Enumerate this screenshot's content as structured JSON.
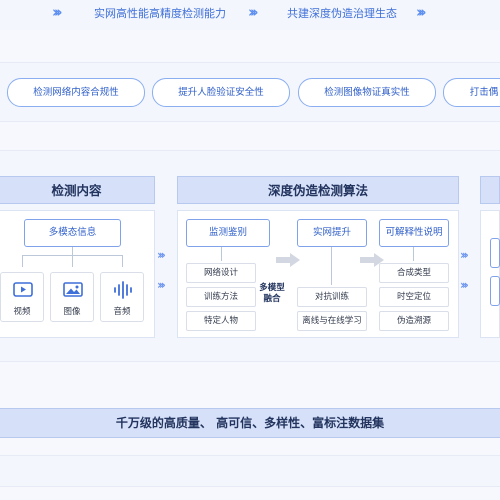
{
  "top_banner": {
    "phrase1": "实网高性能高精度检测能力",
    "phrase2": "共建深度伪造治理生态"
  },
  "goals": [
    "检测网络内容合规性",
    "提升人脸验证安全性",
    "检测图像物证真实性",
    "打击偶"
  ],
  "detect_content": {
    "title": "检测内容",
    "multimodal_label": "多模态信息",
    "modalities": [
      {
        "label": "视频",
        "icon": "video-icon"
      },
      {
        "label": "图像",
        "icon": "image-icon"
      },
      {
        "label": "音频",
        "icon": "audio-wave-icon"
      }
    ]
  },
  "algorithm": {
    "title": "深度伪造检测算法",
    "surveillance": {
      "label": "监测鉴别",
      "items": [
        "网络设计",
        "训练方法",
        "特定人物"
      ]
    },
    "fusion_label": "多模型\n融合",
    "real_net": {
      "label": "实网提升",
      "items": [
        "对抗训练",
        "离线与在线学习"
      ]
    },
    "explainable": {
      "label": "可解释性说明",
      "items": [
        "合成类型",
        "时空定位",
        "伪造溯源"
      ]
    }
  },
  "dataset_banner": "千万级的高质量、 高可信、多样性、富标注数据集",
  "colors": {
    "accent": "#3f6fd8",
    "header_fill": "#d6e1f9",
    "pill_border": "#8aaef0",
    "background": "#f6f8fd"
  }
}
